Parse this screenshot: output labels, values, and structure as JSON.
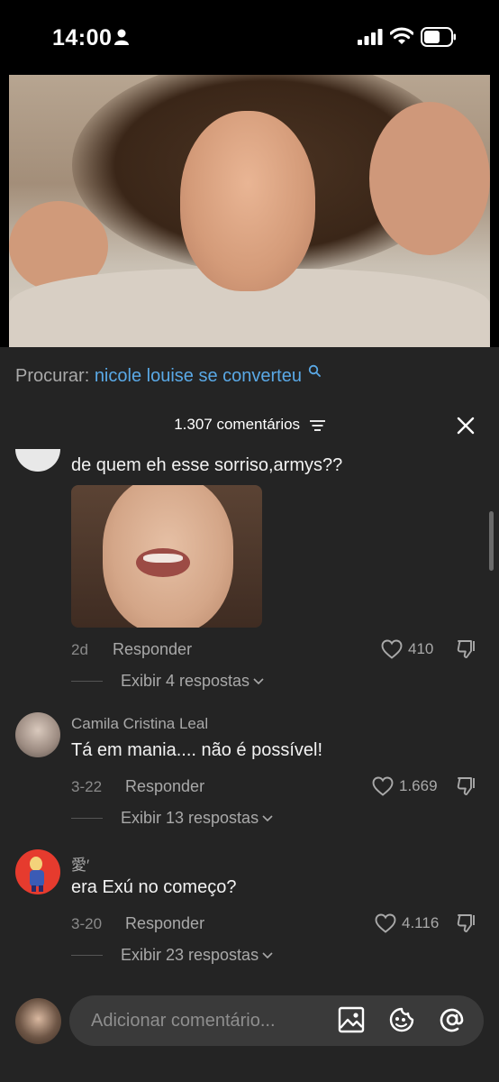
{
  "status_bar": {
    "time": "14:00"
  },
  "search": {
    "label": "Procurar:",
    "query": "nicole louise se converteu"
  },
  "comments_header": {
    "count": "1.307 comentários"
  },
  "comments": [
    {
      "text": "de quem eh esse sorriso,armys??",
      "date": "2d",
      "reply_label": "Responder",
      "likes": "410",
      "view_replies": "Exibir 4 respostas"
    },
    {
      "username": "Camila Cristina Leal",
      "text": "Tá em mania.... não é possível!",
      "date": "3-22",
      "reply_label": "Responder",
      "likes": "1.669",
      "view_replies": "Exibir 13 respostas"
    },
    {
      "username": "愛′",
      "text": "era Exú no começo?",
      "date": "3-20",
      "reply_label": "Responder",
      "likes": "4.116",
      "view_replies": "Exibir 23 respostas"
    }
  ],
  "input": {
    "placeholder": "Adicionar comentário..."
  },
  "colors": {
    "background": "#242424",
    "link": "#5aa9e6",
    "muted": "#a9a9a9"
  }
}
